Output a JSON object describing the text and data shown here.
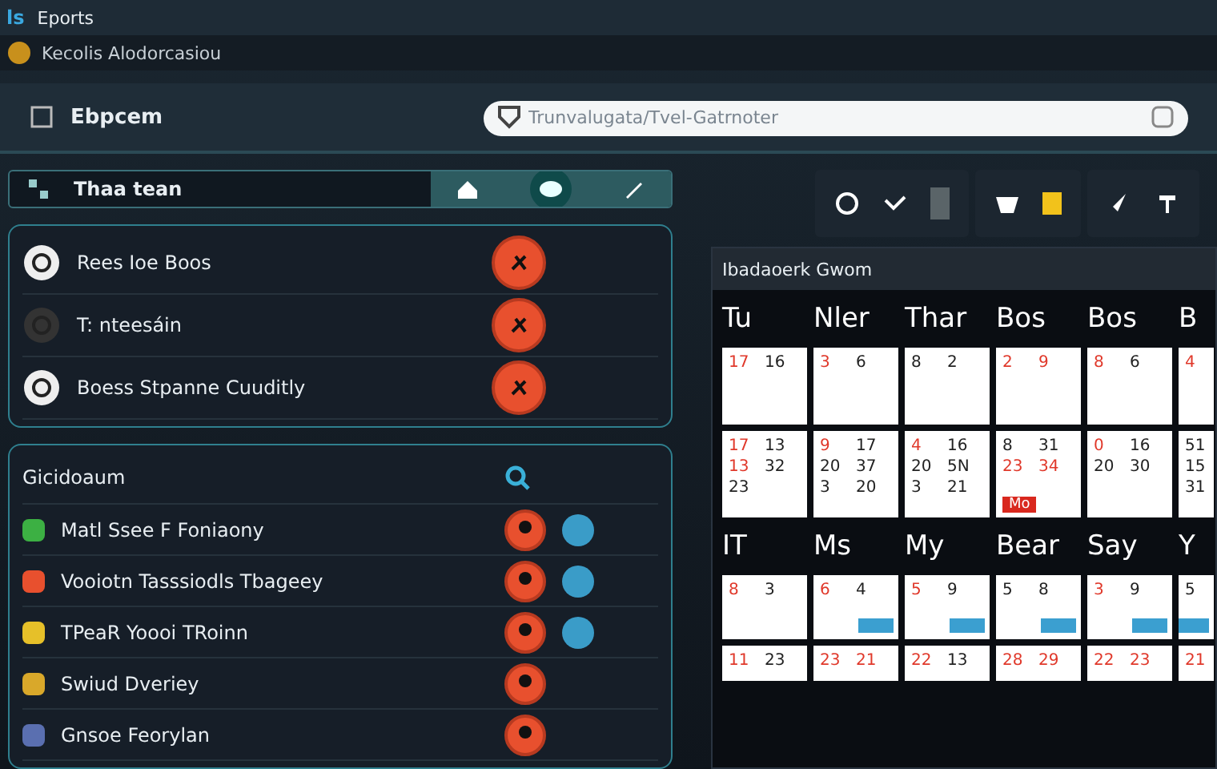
{
  "app_bar": {
    "logo": "ls",
    "title": "Eports"
  },
  "account_bar": {
    "name": "Kecolis Alodorcasiou"
  },
  "header": {
    "title": "Ebpcem",
    "search": {
      "placeholder": "Trunvalugata/Tvel-Gatrnoter"
    }
  },
  "team_bar": {
    "title": "Thaa tean"
  },
  "top_list": [
    {
      "label": "Rees Ioe Boos"
    },
    {
      "label": "T: nteesáin"
    },
    {
      "label": "Boess Stpanne Cuuditly"
    }
  ],
  "contacts": {
    "title": "Gicidoaum",
    "items": [
      {
        "label": "Matl Ssee F Foniaony",
        "color": "#3cb043",
        "globe": true
      },
      {
        "label": "Vooiotn Tasssiodls Tbageey",
        "color": "#e8502e",
        "globe": true
      },
      {
        "label": "TPeaR Yoooi TRoinn",
        "color": "#e6c029",
        "globe": true
      },
      {
        "label": "Swiud Dveriey",
        "color": "#d9a82a",
        "globe": false
      },
      {
        "label": "Gnsoe Feorylan",
        "color": "#5a6fb0",
        "globe": false
      }
    ]
  },
  "calendar": {
    "title": "Ibadaoerk Gwom",
    "weeks": [
      {
        "days": [
          "Tu",
          "Nler",
          "Thar",
          "Bos",
          "Bos",
          "B"
        ],
        "rows": [
          [
            {
              "numbers": [
                {
                  "text": "17",
                  "red": true
                },
                {
                  "text": "16",
                  "red": false
                }
              ]
            },
            {
              "numbers": [
                {
                  "text": "3",
                  "red": true
                },
                {
                  "text": "6",
                  "red": false
                }
              ]
            },
            {
              "numbers": [
                {
                  "text": "8",
                  "red": false
                },
                {
                  "text": "2",
                  "red": false
                }
              ]
            },
            {
              "numbers": [
                {
                  "text": "2",
                  "red": true
                },
                {
                  "text": "9",
                  "red": true
                }
              ]
            },
            {
              "numbers": [
                {
                  "text": "8",
                  "red": true
                },
                {
                  "text": "6",
                  "red": false
                }
              ]
            },
            {
              "numbers": [
                {
                  "text": "4",
                  "red": true
                }
              ]
            }
          ],
          [
            {
              "numbers": [
                {
                  "text": "17",
                  "red": true
                },
                {
                  "text": "13",
                  "red": false
                },
                {
                  "text": "13",
                  "red": true
                },
                {
                  "text": "32",
                  "red": false
                },
                {
                  "text": "23",
                  "red": false
                }
              ]
            },
            {
              "numbers": [
                {
                  "text": "9",
                  "red": true
                },
                {
                  "text": "17",
                  "red": false
                },
                {
                  "text": "20",
                  "red": false
                },
                {
                  "text": "37",
                  "red": false
                },
                {
                  "text": "3",
                  "red": false
                },
                {
                  "text": "20",
                  "red": false
                }
              ]
            },
            {
              "numbers": [
                {
                  "text": "4",
                  "red": true
                },
                {
                  "text": "16",
                  "red": false
                },
                {
                  "text": "20",
                  "red": false
                },
                {
                  "text": "5N",
                  "red": false
                },
                {
                  "text": "3",
                  "red": false
                },
                {
                  "text": "21",
                  "red": false
                }
              ]
            },
            {
              "numbers": [
                {
                  "text": "8",
                  "red": false
                },
                {
                  "text": "31",
                  "red": false
                },
                {
                  "text": "23",
                  "red": true
                },
                {
                  "text": "34",
                  "red": true
                }
              ],
              "badge": "Mo"
            },
            {
              "numbers": [
                {
                  "text": "0",
                  "red": true
                },
                {
                  "text": "16",
                  "red": false
                },
                {
                  "text": "20",
                  "red": false
                },
                {
                  "text": "30",
                  "red": false
                }
              ]
            },
            {
              "numbers": [
                {
                  "text": "51",
                  "red": false
                },
                {
                  "text": "15",
                  "red": false
                },
                {
                  "text": "31",
                  "red": false
                }
              ]
            }
          ]
        ]
      },
      {
        "days": [
          "IT",
          "Ms",
          "My",
          "Bear",
          "Say",
          "Y"
        ],
        "rows": [
          [
            {
              "numbers": [
                {
                  "text": "8",
                  "red": true
                },
                {
                  "text": "3",
                  "red": false
                }
              ],
              "event": false
            },
            {
              "numbers": [
                {
                  "text": "6",
                  "red": true
                },
                {
                  "text": "4",
                  "red": false
                }
              ],
              "event": true
            },
            {
              "numbers": [
                {
                  "text": "5",
                  "red": true
                },
                {
                  "text": "9",
                  "red": false
                }
              ],
              "event": true
            },
            {
              "numbers": [
                {
                  "text": "5",
                  "red": false
                },
                {
                  "text": "8",
                  "red": false
                }
              ],
              "event": true
            },
            {
              "numbers": [
                {
                  "text": "3",
                  "red": true
                },
                {
                  "text": "9",
                  "red": false
                }
              ],
              "event": true
            },
            {
              "numbers": [
                {
                  "text": "5",
                  "red": false
                }
              ],
              "event": true
            }
          ],
          [
            {
              "numbers": [
                {
                  "text": "11",
                  "red": true
                },
                {
                  "text": "23",
                  "red": false
                }
              ]
            },
            {
              "numbers": [
                {
                  "text": "23",
                  "red": true
                },
                {
                  "text": "21",
                  "red": true
                }
              ]
            },
            {
              "numbers": [
                {
                  "text": "22",
                  "red": true
                },
                {
                  "text": "13",
                  "red": false
                }
              ]
            },
            {
              "numbers": [
                {
                  "text": "28",
                  "red": true
                },
                {
                  "text": "29",
                  "red": true
                }
              ]
            },
            {
              "numbers": [
                {
                  "text": "22",
                  "red": true
                },
                {
                  "text": "23",
                  "red": true
                }
              ]
            },
            {
              "numbers": [
                {
                  "text": "21",
                  "red": true
                }
              ]
            }
          ]
        ]
      }
    ]
  }
}
